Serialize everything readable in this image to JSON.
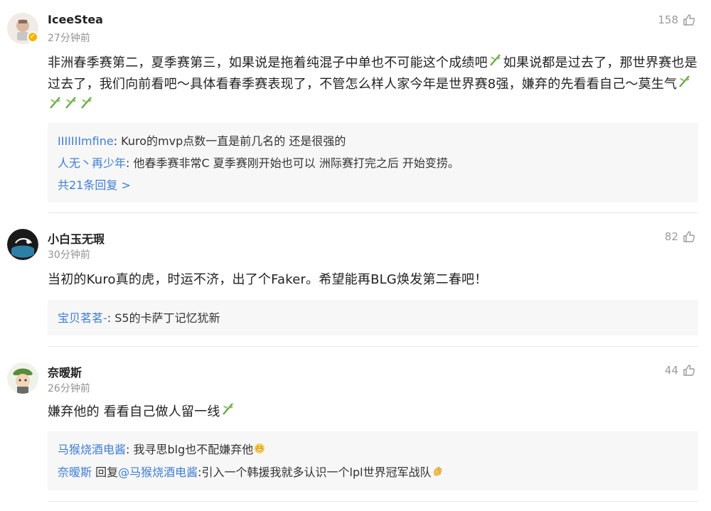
{
  "comments": [
    {
      "username": "IceeStea",
      "time": "27分钟前",
      "likes": "158",
      "verified": true,
      "body_a": "非洲春季赛第二，夏季赛第三，如果说是拖着纯混子中单也不可能这个成绩吧",
      "body_b": "如果说都是过去了，那世界赛也是过去了，我们向前看吧～具体看春季赛表现了，不管怎么样人家今年是世界赛8强，嫌弃的先看看自己～莫生气",
      "replies": [
        {
          "user": "IIIIIIImfine",
          "text": ": Kuro的mvp点数一直是前几名的 还是很强的"
        },
        {
          "user": "人无丶再少年",
          "text": ": 他春季赛非常C  夏季赛刚开始也可以  洲际赛打完之后 开始变捞。"
        }
      ],
      "more": "共21条回复 >"
    },
    {
      "username": "小白玉无瑕",
      "time": "30分钟前",
      "likes": "82",
      "body": "当初的Kuro真的虎，时运不济，出了个Faker。希望能再BLG焕发第二春吧！",
      "replies": [
        {
          "user": "宝贝茗茗-",
          "text": ": S5的卡萨丁记忆犹新"
        }
      ]
    },
    {
      "username": "奈暧斯",
      "time": "26分钟前",
      "likes": "44",
      "body": "嫌弃他的 看看自己做人留一线",
      "replies": [
        {
          "user": "马猴烧酒电酱",
          "text": ": 我寻思blg也不配嫌弃他"
        },
        {
          "user": "奈暧斯",
          "mid": " 回复",
          "mention": "@马猴烧酒电酱",
          "text": ":引入一个韩援我就多认识一个lpl世界冠军战队"
        }
      ]
    }
  ],
  "colors": {
    "link": "#3f7fd3",
    "meta": "#939393",
    "reply_bg": "#f7f7f7"
  },
  "icons": [
    "thumb-up-icon",
    "bamboo-emoji-icon",
    "grin-emoji-icon",
    "clap-emoji-icon",
    "verified-badge-icon"
  ]
}
